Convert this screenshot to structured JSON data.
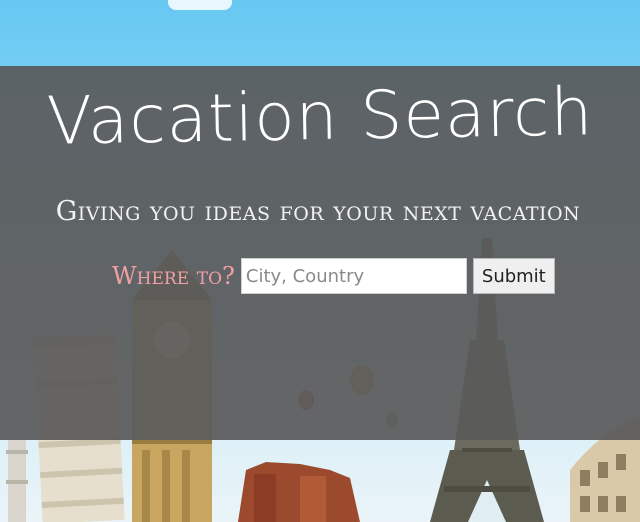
{
  "hero": {
    "title": "Vacation Search",
    "subtitle": "Giving you ideas for your next vacation"
  },
  "search": {
    "label": "Where to?",
    "placeholder": "City, Country",
    "value": "",
    "submit_label": "Submit"
  },
  "colors": {
    "overlay": "#5a5a5a",
    "label_accent": "#f0a0a4",
    "sky": "#67c8f2"
  }
}
